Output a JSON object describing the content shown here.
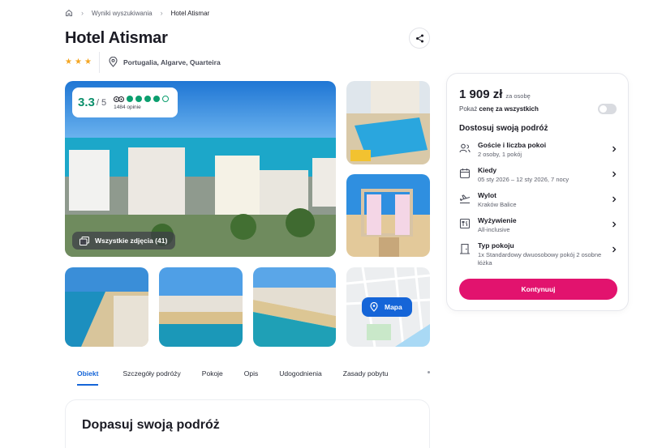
{
  "breadcrumb": {
    "results": "Wyniki wyszukiwania",
    "current": "Hotel Atismar"
  },
  "hotel": {
    "name": "Hotel Atismar",
    "stars": 3,
    "location": "Portugalia, Algarve, Quarteira"
  },
  "rating": {
    "score": "3.3",
    "max": "/ 5",
    "reviews": "1484 opinie",
    "dots": 4.5
  },
  "gallery": {
    "all_photos": "Wszystkie zdjęcia (41)",
    "map": "Mapa"
  },
  "tabs": [
    "Obiekt",
    "Szczegóły podróży",
    "Pokoje",
    "Opis",
    "Udogodnienia",
    "Zasady pobytu"
  ],
  "section": {
    "title": "Dopasuj swoją podróż"
  },
  "booking": {
    "price": "1 909 zł",
    "price_unit": "za osobę",
    "toggle_prefix": "Pokaż",
    "toggle_bold": "cenę za wszystkich",
    "adjust_title": "Dostosuj swoją podróż",
    "options": [
      {
        "label": "Goście i liczba pokoi",
        "value": "2 osoby, 1 pokój",
        "icon": "guests-icon"
      },
      {
        "label": "Kiedy",
        "value": "05 sty 2026 – 12 sty 2026, 7 nocy",
        "icon": "calendar-icon"
      },
      {
        "label": "Wylot",
        "value": "Kraków Balice",
        "icon": "plane-icon"
      },
      {
        "label": "Wyżywienie",
        "value": "All-inclusive",
        "icon": "food-icon"
      },
      {
        "label": "Typ pokoju",
        "value": "1x Standardowy dwuosobowy pokój 2 osobne łóżka",
        "icon": "door-icon"
      }
    ],
    "continue": "Kontynuuj"
  },
  "colors": {
    "accent": "#e2136e",
    "link": "#1565d8",
    "rating": "#0b9e6e",
    "star": "#f4a623"
  }
}
